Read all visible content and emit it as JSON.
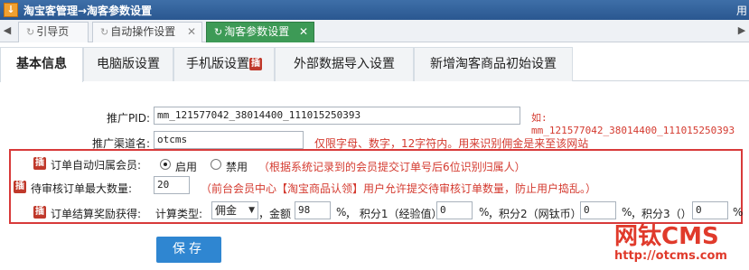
{
  "titlebar": {
    "logo": "↓",
    "title": "淘宝客管理→淘客参数设置",
    "right_text": "用"
  },
  "window_tabs": [
    {
      "label": "引导页",
      "closable": false
    },
    {
      "label": "自动操作设置",
      "closable": true
    },
    {
      "label": "淘客参数设置",
      "closable": true,
      "active": true
    }
  ],
  "content_tabs": [
    {
      "label": "基本信息",
      "active": true
    },
    {
      "label": "电脑版设置"
    },
    {
      "label": "手机版设置",
      "badge": "插"
    },
    {
      "label": "外部数据导入设置"
    },
    {
      "label": "新增淘客商品初始设置"
    }
  ],
  "form": {
    "pid": {
      "label": "推广PID:",
      "value": "mm_121577042_38014400_111015250393",
      "hint": "如: mm_121577042_38014400_111015250393"
    },
    "channel": {
      "label": "推广渠道名:",
      "value": "otcms",
      "hint": "仅限字母、数字，12字符内。用来识别佣金是来至该网站"
    },
    "auto_belong": {
      "badge": "插",
      "label": "订单自动归属会员:",
      "option_on": "启用",
      "option_off": "禁用",
      "selected": "启用",
      "hint": "（根据系统记录到的会员提交订单号后6位识别归属人）"
    },
    "max_orders": {
      "badge": "插",
      "label": "待审核订单最大数量:",
      "value": "20",
      "hint": "（前台会员中心【淘宝商品认领】用户允许提交待审核订单数量，防止用户捣乱。）"
    },
    "reward": {
      "badge": "插",
      "label": "订单结算奖励获得:",
      "calc_label": "计算类型:",
      "calc_value": "佣金",
      "amount_label": "，金额",
      "amount_value": "98",
      "amount_unit": "%",
      "score1_label": "， 积分1（经验值）",
      "score1_value": "0",
      "score1_unit": "%",
      "score2_label": "，积分2（网钛币）",
      "score2_value": "0",
      "score2_unit": "%",
      "score3_label": "，积分3（）",
      "score3_value": "0",
      "score3_unit": "%"
    }
  },
  "save_label": "保存",
  "watermark": {
    "brand": "网钛CMS",
    "url": "http://otcms.com"
  }
}
